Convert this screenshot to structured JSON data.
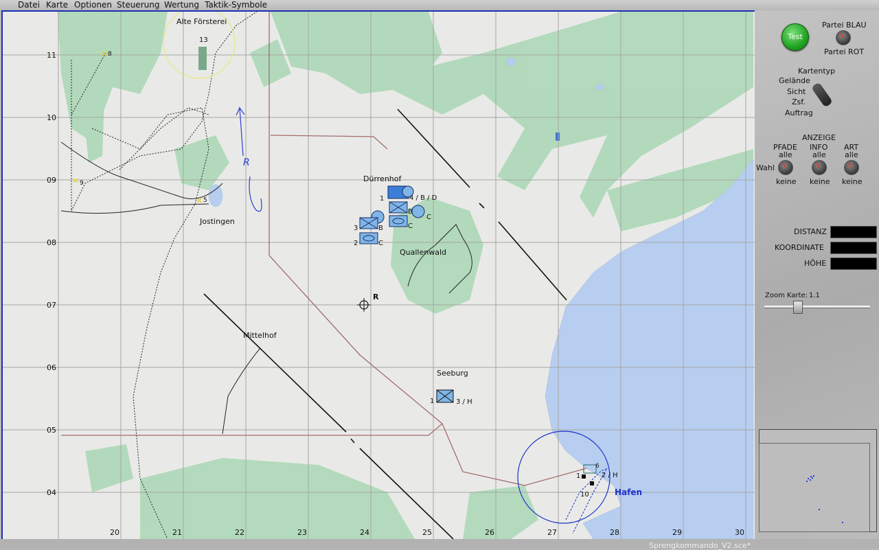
{
  "menu": [
    "Datei",
    "Karte",
    "Optionen",
    "Steuerung",
    "Wertung",
    "Taktik-Symbole"
  ],
  "colors": {
    "frame": "#1d2fb3",
    "map_background": "#e9eae7",
    "vegetation": "#a9d7b4",
    "water": "#b7cef0",
    "grid": "#a5a5a5",
    "route": "#a26b6b",
    "unit_blue": "#7fb6e6",
    "test_button": "#22a322"
  },
  "map": {
    "x_grid": [
      "20",
      "21",
      "22",
      "23",
      "24",
      "25",
      "26",
      "27",
      "28",
      "29",
      "30"
    ],
    "y_grid": [
      "11",
      "10",
      "09",
      "08",
      "07",
      "06",
      "05",
      "04"
    ],
    "places": {
      "alte_foersterei": "Alte Försterei",
      "duerrenhof": "Dürrenhof",
      "jostingen": "Jostingen",
      "quallenwald": "Quallenwald",
      "mittelhof": "Mittelhof",
      "seeburg": "Seeburg",
      "hafen": "Hafen"
    },
    "markers": {
      "r_marker": "R",
      "forester_number": "13",
      "waypoint_8": "8",
      "waypoint_9": "9",
      "waypoint_5": "5",
      "harbor_number": "10",
      "seeburg_unit_num": "1",
      "seeburg_unit_label": "3 / H",
      "harbor_unit_num": "1",
      "harbor_unit_label": "2 / H",
      "harbor_unit_small": "6",
      "drawn_letter": "R"
    },
    "units": {
      "u1_label": "4 / B / D",
      "u1_num": "1",
      "u2_label": "B",
      "u3_label": "C",
      "u4_label": "B",
      "u4_num": "3",
      "u5_label": "C",
      "u5_num": "2",
      "u6_label": "C"
    }
  },
  "panel": {
    "test_button": "Test",
    "party_blue": "Partei BLAU",
    "party_red": "Partei ROT",
    "map_type_label": "Kartentyp",
    "map_types": [
      "Gelände",
      "Sicht",
      "Zsf.",
      "Auftrag"
    ],
    "display_label": "ANZEIGE",
    "paths_label": "PFADE",
    "info_label": "INFO",
    "art_label": "ART",
    "all_label": "alle",
    "none_label": "keine",
    "choice_label": "Wahl",
    "distance_label": "DISTANZ",
    "coordinate_label": "KOORDINATE",
    "height_label": "HÖHE",
    "zoom_label": "Zoom Karte:",
    "zoom_value": "1.1"
  },
  "status": {
    "file_name": "Sprengkommando_V2.sce*"
  }
}
